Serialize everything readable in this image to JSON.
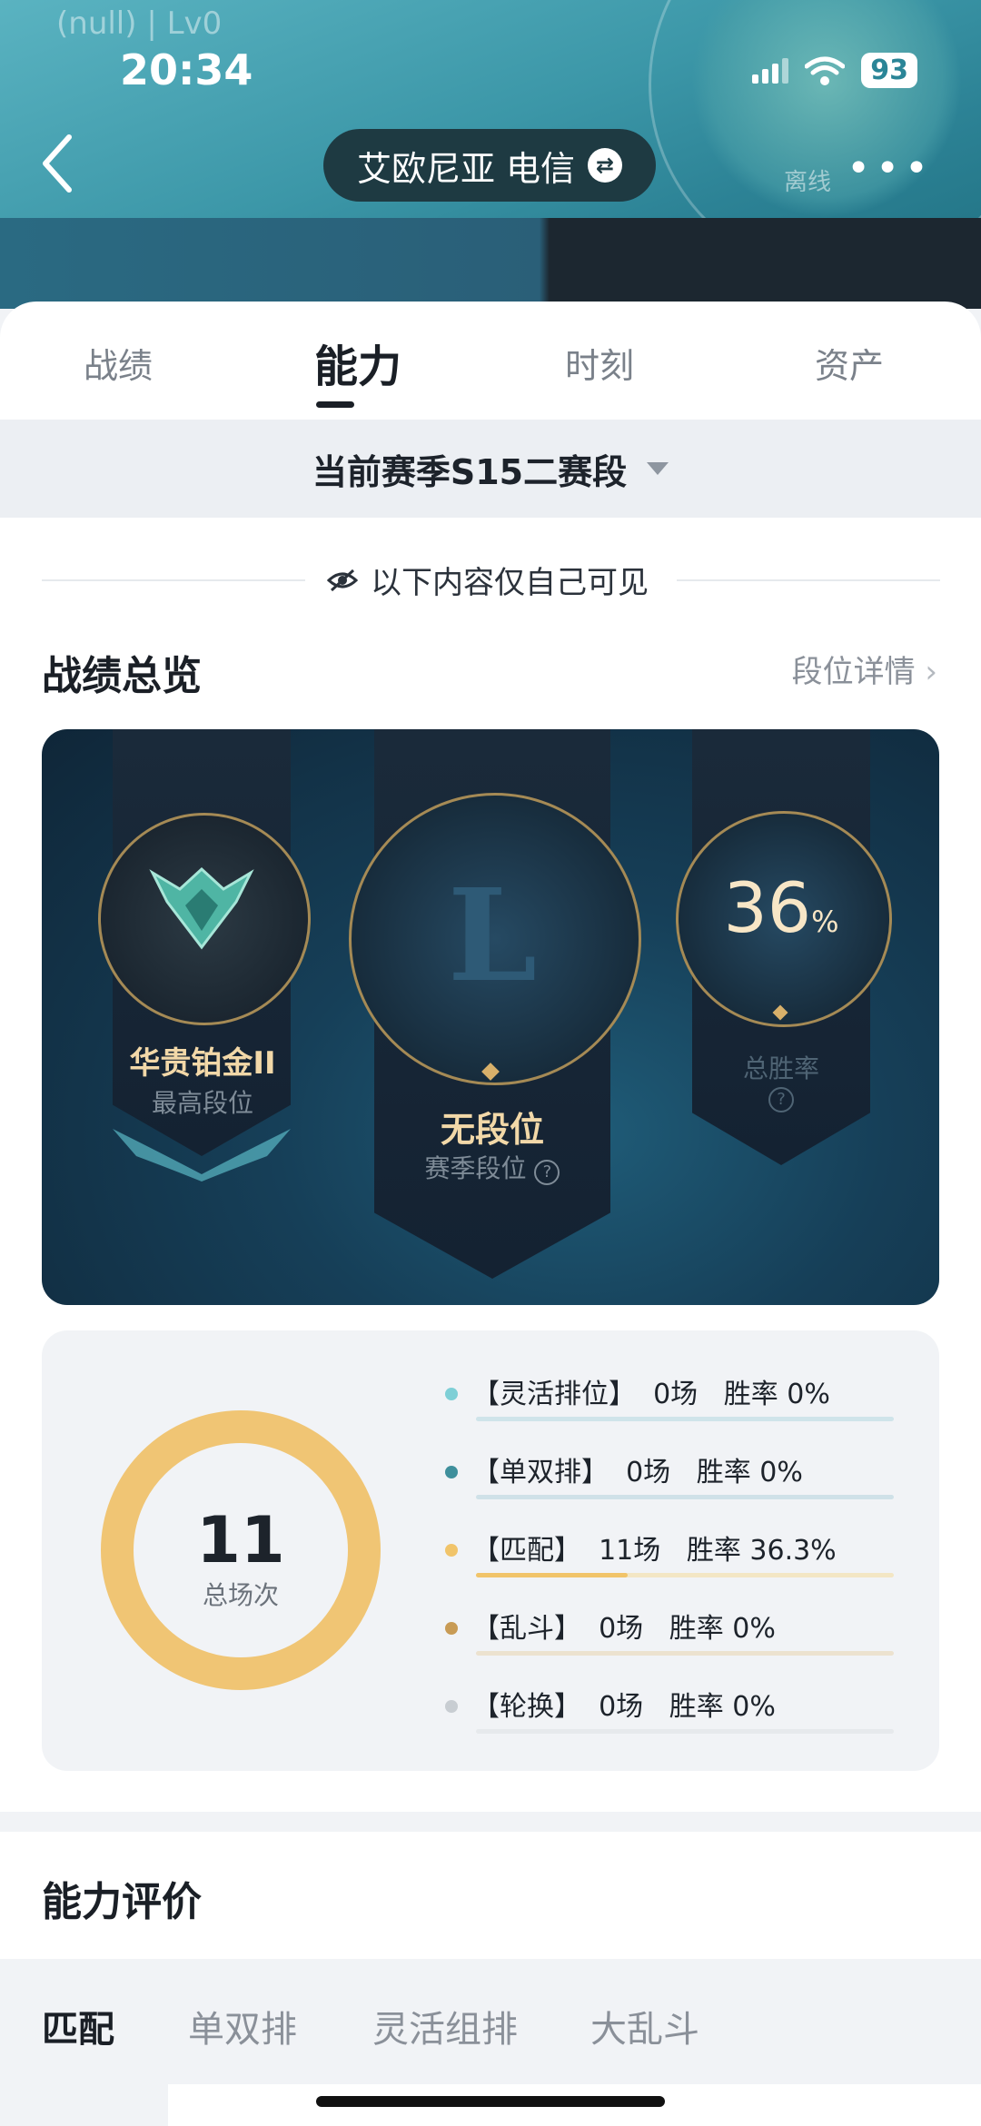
{
  "status_bar": {
    "null_label": "(null) | Lv0",
    "time": "20:34",
    "battery": "93"
  },
  "header": {
    "server": "艾欧尼亚  电信",
    "offline": "离线"
  },
  "tabs": [
    {
      "label": "战绩"
    },
    {
      "label": "能力"
    },
    {
      "label": "时刻"
    },
    {
      "label": "资产"
    }
  ],
  "season": {
    "label": "当前赛季S15二赛段"
  },
  "privacy_note": "以下内容仅自己可见",
  "overview": {
    "title": "战绩总览",
    "detail_link": "段位详情",
    "highest_rank": {
      "name": "华贵铂金II",
      "label": "最高段位"
    },
    "season_rank": {
      "name": "无段位",
      "label": "赛季段位",
      "logo": "L"
    },
    "win_rate": {
      "value": "36",
      "unit": "%",
      "label": "总胜率"
    }
  },
  "stats": {
    "total": "11",
    "total_label": "总场次",
    "modes": [
      {
        "text": "【灵活排位】  0场   胜率 0%",
        "color": "#7ecfd6",
        "bar_color": "#cfe4ea",
        "fill_color": "#7ecfd6",
        "fill": 0
      },
      {
        "text": "【单双排】  0场   胜率 0%",
        "color": "#3f8f9c",
        "bar_color": "#cfe1e8",
        "fill_color": "#3f8f9c",
        "fill": 0
      },
      {
        "text": "【匹配】  11场   胜率 36.3%",
        "color": "#f1c46a",
        "bar_color": "#f3e6c4",
        "fill_color": "#f1c46a",
        "fill": 0.363
      },
      {
        "text": "【乱斗】  0场   胜率 0%",
        "color": "#c89b55",
        "bar_color": "#ece2cf",
        "fill_color": "#c89b55",
        "fill": 0
      },
      {
        "text": "【轮换】  0场   胜率 0%",
        "color": "#c8cdd2",
        "bar_color": "#e6e9ec",
        "fill_color": "#c8cdd2",
        "fill": 0
      }
    ],
    "donut_color": "#f0c574"
  },
  "ability": {
    "title": "能力评价",
    "sub_tabs": [
      {
        "label": "匹配"
      },
      {
        "label": "单双排"
      },
      {
        "label": "灵活组排"
      },
      {
        "label": "大乱斗"
      }
    ]
  }
}
